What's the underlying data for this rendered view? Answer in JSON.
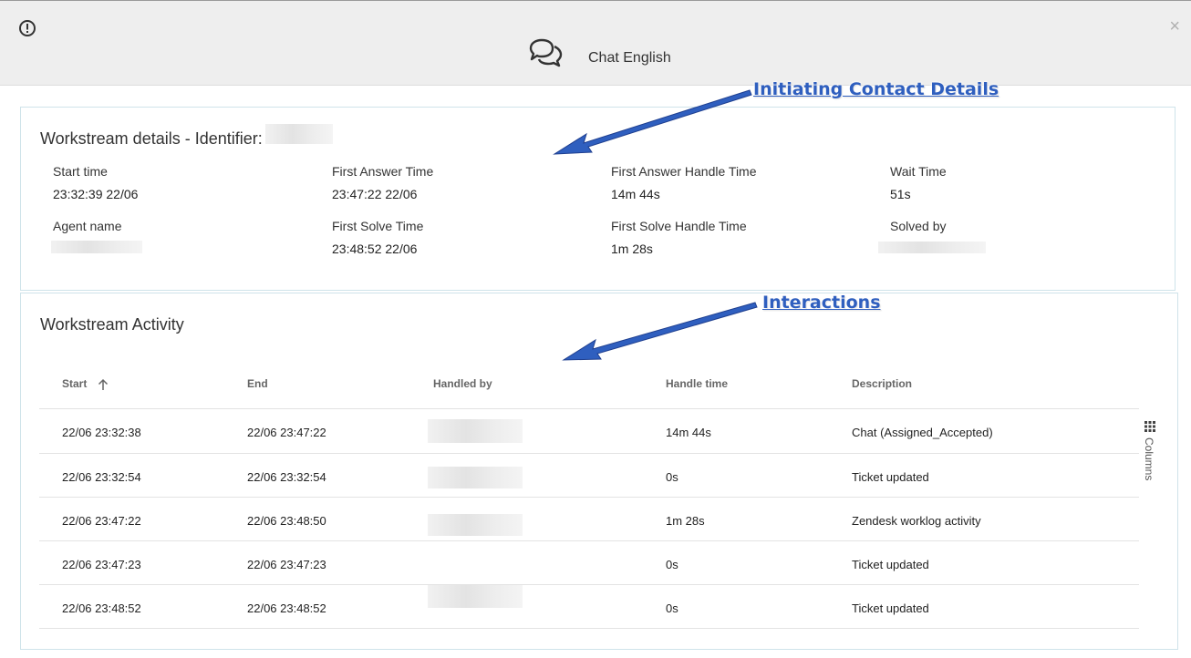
{
  "header": {
    "title": "Chat English",
    "close_glyph": "×",
    "icons": {
      "alert": "alert-circle-icon",
      "chat": "chat-bubbles-icon",
      "close": "close-icon"
    }
  },
  "annotations": {
    "details": "Initiating Contact Details",
    "interactions": "Interactions",
    "color": "#2f5fbf"
  },
  "details": {
    "title": "Workstream details - Identifier:",
    "fields": [
      {
        "label": "Start time",
        "value": "23:32:39 22/06"
      },
      {
        "label": "First Answer Time",
        "value": "23:47:22 22/06"
      },
      {
        "label": "First Answer Handle Time",
        "value": "14m 44s"
      },
      {
        "label": "Wait Time",
        "value": "51s"
      },
      {
        "label": "Agent name",
        "value": ""
      },
      {
        "label": "First Solve Time",
        "value": "23:48:52 22/06"
      },
      {
        "label": "First Solve Handle Time",
        "value": "1m 28s"
      },
      {
        "label": "Solved by",
        "value": ""
      }
    ]
  },
  "activity": {
    "title": "Workstream Activity",
    "columns": [
      "Start",
      "End",
      "Handled by",
      "Handle time",
      "Description"
    ],
    "rows": [
      {
        "start": "22/06 23:32:38",
        "end": "22/06 23:47:22",
        "handled_by": "",
        "handle_time": "14m 44s",
        "description": "Chat (Assigned_Accepted)"
      },
      {
        "start": "22/06 23:32:54",
        "end": "22/06 23:32:54",
        "handled_by": "",
        "handle_time": "0s",
        "description": "Ticket updated"
      },
      {
        "start": "22/06 23:47:22",
        "end": "22/06 23:48:50",
        "handled_by": "",
        "handle_time": "1m 28s",
        "description": "Zendesk worklog activity"
      },
      {
        "start": "22/06 23:47:23",
        "end": "22/06 23:47:23",
        "handled_by": "",
        "handle_time": "0s",
        "description": "Ticket updated"
      },
      {
        "start": "22/06 23:48:52",
        "end": "22/06 23:48:52",
        "handled_by": "",
        "handle_time": "0s",
        "description": "Ticket updated"
      }
    ],
    "columns_button": "Columns",
    "sort_icon": "arrow-up-icon",
    "columns_icon": "grid-icon"
  }
}
